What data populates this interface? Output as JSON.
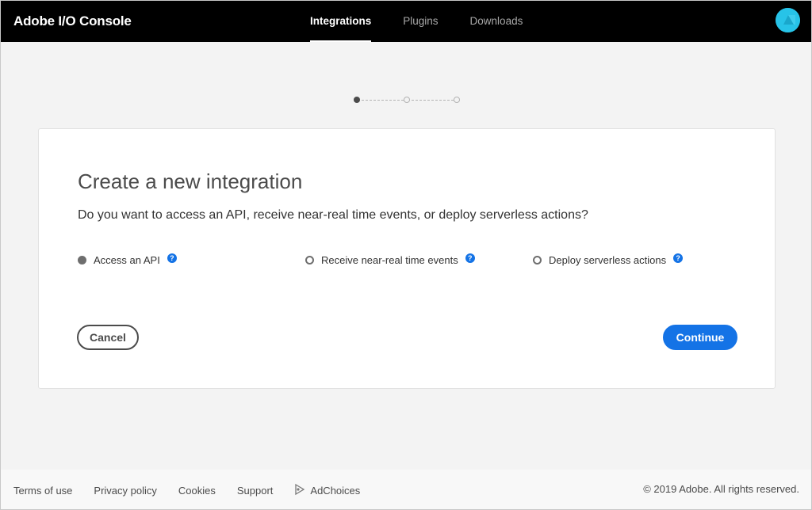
{
  "app": {
    "title": "Adobe I/O Console"
  },
  "nav": {
    "items": [
      {
        "label": "Integrations",
        "active": true
      },
      {
        "label": "Plugins",
        "active": false
      },
      {
        "label": "Downloads",
        "active": false
      }
    ]
  },
  "avatar": {
    "icon": "user-avatar-icon",
    "color": "#27c3e8"
  },
  "stepper": {
    "current_step": 1,
    "total_steps": 3
  },
  "card": {
    "title": "Create a new integration",
    "question": "Do you want to access an API, receive near-real time events, or deploy serverless actions?",
    "options": [
      {
        "label": "Access an API",
        "selected": true,
        "help_icon": "help-icon"
      },
      {
        "label": "Receive near-real time events",
        "selected": false,
        "help_icon": "help-icon"
      },
      {
        "label": "Deploy serverless actions",
        "selected": false,
        "help_icon": "help-icon"
      }
    ],
    "help_glyph": "?",
    "cancel_label": "Cancel",
    "continue_label": "Continue"
  },
  "footer": {
    "links": [
      "Terms of use",
      "Privacy policy",
      "Cookies",
      "Support",
      "AdChoices"
    ],
    "copyright": "© 2019 Adobe. All rights reserved."
  },
  "colors": {
    "accent": "#1473e6",
    "topbar": "#000000",
    "background": "#f3f3f3"
  }
}
